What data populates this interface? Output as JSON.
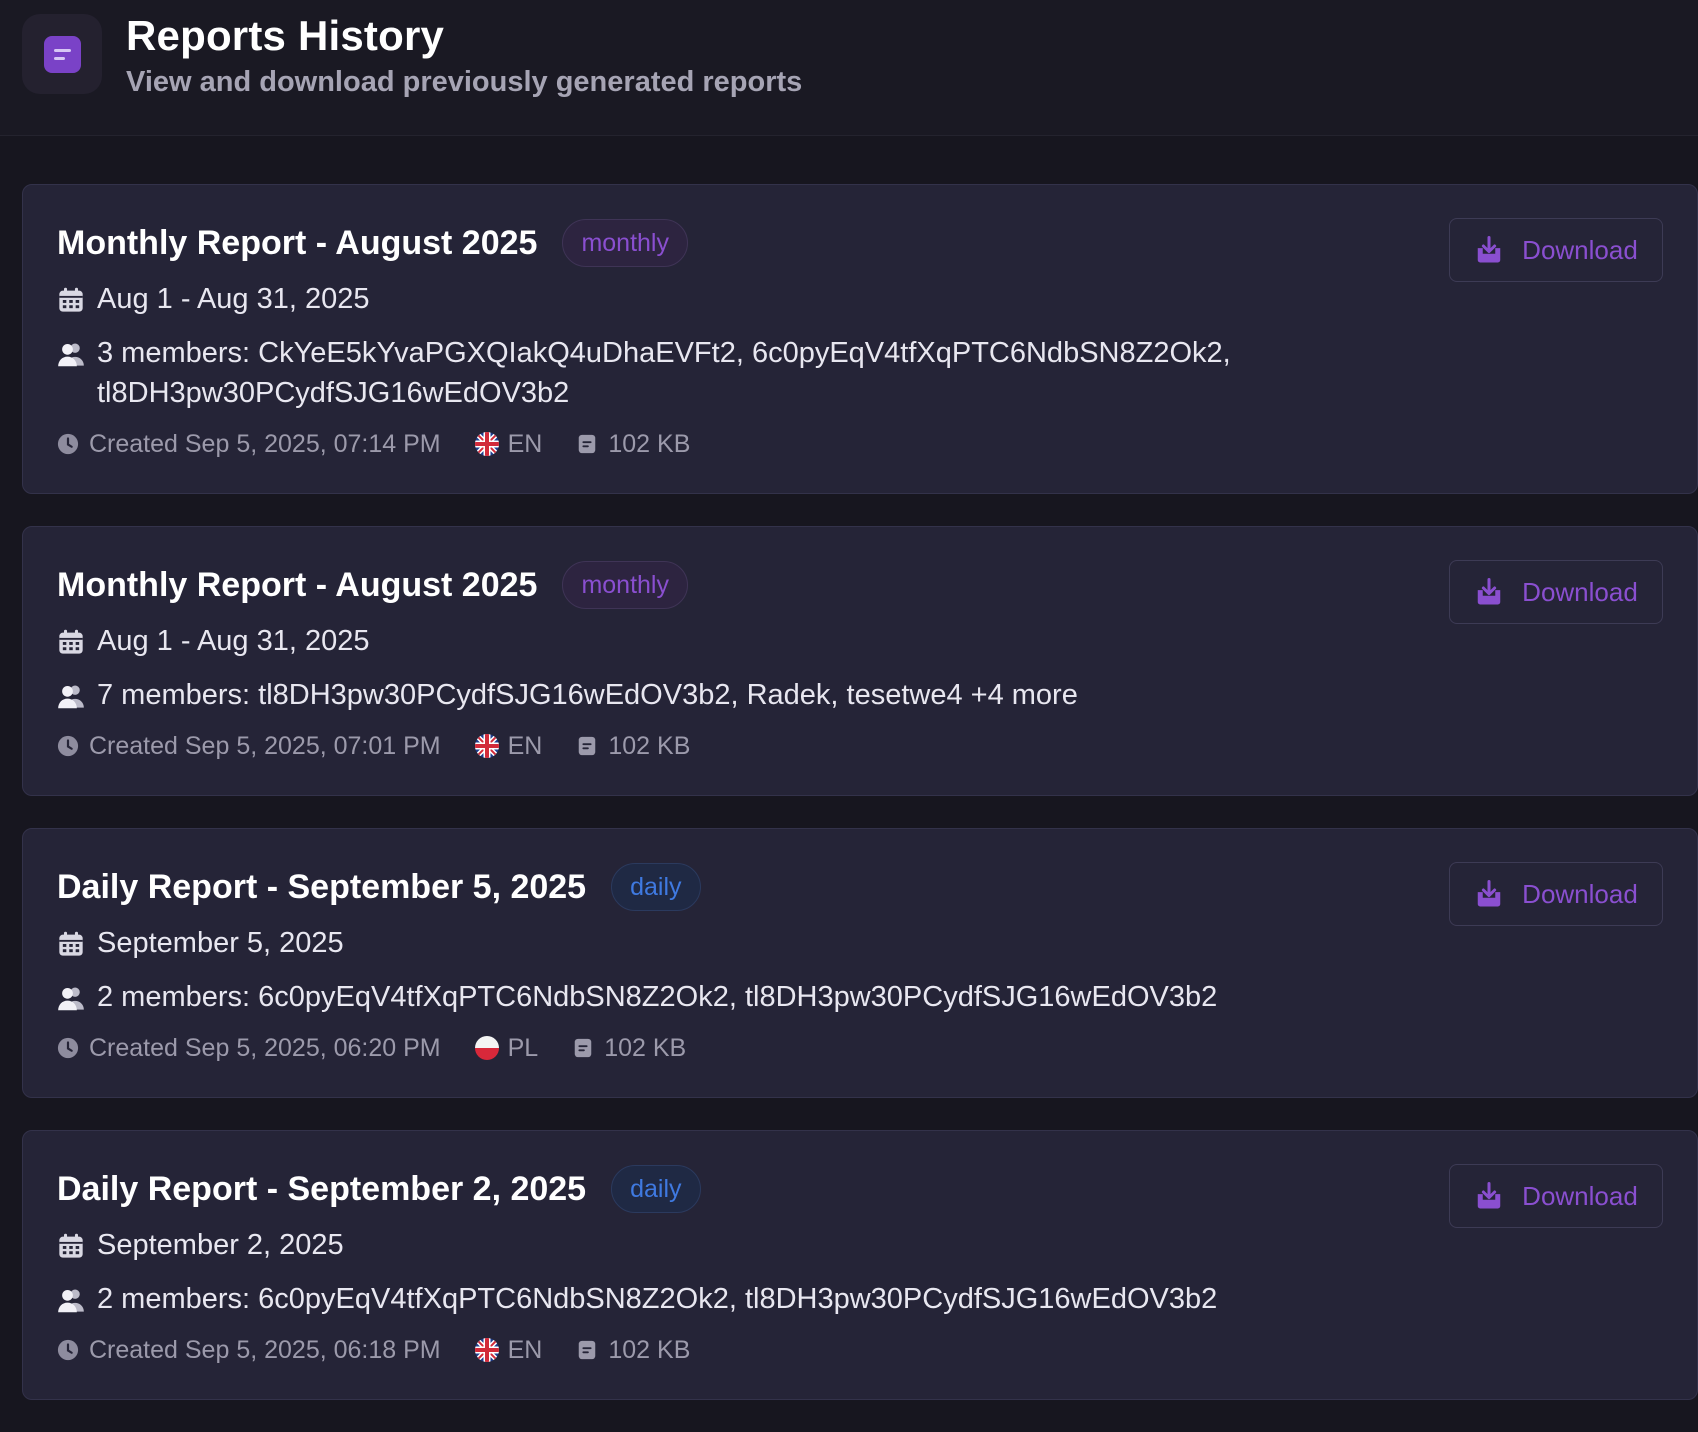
{
  "header": {
    "title": "Reports History",
    "subtitle": "View and download previously generated reports",
    "icon": "report-icon"
  },
  "colors": {
    "accent": "#8a4fd0",
    "monthly_badge": "#8a4fd0",
    "daily_badge": "#3f79e0",
    "card_bg": "#252437",
    "page_bg": "#17161f"
  },
  "download_label": "Download",
  "reports": [
    {
      "title": "Monthly Report - August 2025",
      "type": "monthly",
      "period": "Aug 1 - Aug 31, 2025",
      "members": "3 members: CkYeE5kYvaPGXQIakQ4uDhaEVFt2, 6c0pyEqV4tfXqPTC6NdbSN8Z2Ok2, tl8DH3pw30PCydfSJG16wEdOV3b2",
      "created": "Created Sep 5, 2025, 07:14 PM",
      "language": "EN",
      "size": "102 KB"
    },
    {
      "title": "Monthly Report - August 2025",
      "type": "monthly",
      "period": "Aug 1 - Aug 31, 2025",
      "members": "7 members: tl8DH3pw30PCydfSJG16wEdOV3b2, Radek, tesetwe4 +4 more",
      "created": "Created Sep 5, 2025, 07:01 PM",
      "language": "EN",
      "size": "102 KB"
    },
    {
      "title": "Daily Report - September 5, 2025",
      "type": "daily",
      "period": "September 5, 2025",
      "members": "2 members: 6c0pyEqV4tfXqPTC6NdbSN8Z2Ok2, tl8DH3pw30PCydfSJG16wEdOV3b2",
      "created": "Created Sep 5, 2025, 06:20 PM",
      "language": "PL",
      "size": "102 KB"
    },
    {
      "title": "Daily Report - September 2, 2025",
      "type": "daily",
      "period": "September 2, 2025",
      "members": "2 members: 6c0pyEqV4tfXqPTC6NdbSN8Z2Ok2, tl8DH3pw30PCydfSJG16wEdOV3b2",
      "created": "Created Sep 5, 2025, 06:18 PM",
      "language": "EN",
      "size": "102 KB"
    }
  ]
}
